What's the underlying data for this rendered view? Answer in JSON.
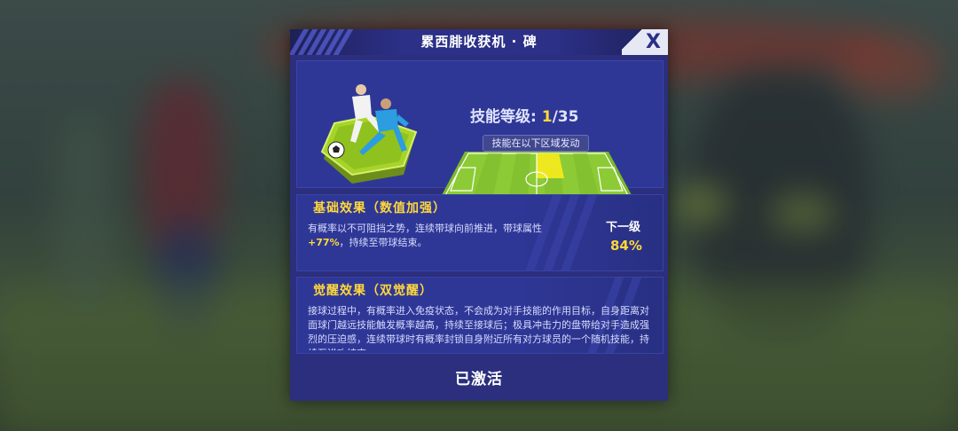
{
  "dialog": {
    "title": "累西腓收获机 · 碑",
    "close_label": "X"
  },
  "skill": {
    "level_label": "技能等级:",
    "level_current": "1",
    "level_max": "/35",
    "area_label": "技能在以下区域发动"
  },
  "base_effect": {
    "title": "基础效果（数值加强）",
    "desc_before": "有概率以不可阻挡之势，连续带球向前推进，带球属性",
    "desc_highlight": "+77%",
    "desc_after": "，持续至带球结束。",
    "next_label": "下一级",
    "next_value": "84%"
  },
  "awake_effect": {
    "title": "觉醒效果（双觉醒）",
    "desc": "接球过程中，有概率进入免疫状态，不会成为对手技能的作用目标，自身距离对面球门越远技能触发概率越高，持续至接球后；极具冲击力的盘带给对手造成强烈的压迫感，连续带球时有概率封锁自身附近所有对方球员的一个随机技能，持续至进攻结束。"
  },
  "footer": {
    "status": "已激活"
  },
  "colors": {
    "panel": "#2b2f7e",
    "highlight": "#ffd83a",
    "pitch_active_zone": "#f2ea1e"
  }
}
